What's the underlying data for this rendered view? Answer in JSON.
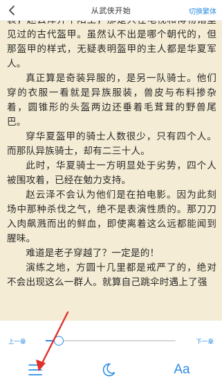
{
  "header": {
    "title": "从武侠开始",
    "action_label": "切换繁体"
  },
  "content": {
    "paragraphs": [
      "装，赵云泽并不陌生，那是只在电视和博物馆里见过的古代盔甲。虽然认不出是哪个朝代的，但那盔甲的样式，无疑表明盔甲的主人都是华夏军人。",
      "真正算是奇装异服的，是另一队骑士。他们穿的衣服一看就是异族服装，兽皮与布料掺杂着，圆锥形的头盔两边还垂着毛茸茸的野兽尾巴。",
      "穿华夏盔甲的骑士人数很少，只有四个人。而那队异族骑士，却有二三十人。",
      "此时，华夏骑士一方明显处于劣势，四个人被围攻着，已经在勉力支持。",
      "赵云泽不会认为他们是在拍电影。因为此刻场中那种杀伐之气，绝不是表演性质的。那刀刀入肉飙溅而出的鲜血，即使离着这么远都能闻到腥味。",
      "难道是老子穿越了？一定是的！",
      "演练之地，方圆十几里都是戒严了的，绝对不会出现这么一群人。就算自己跳伞时遇上了强"
    ]
  },
  "toolbar": {
    "prev_label": "上一章",
    "next_label": "下一章",
    "progress_percent": 10,
    "accent_color": "#2f8de4",
    "tools": [
      {
        "icon": "menu-icon"
      },
      {
        "icon": "moon-icon"
      },
      {
        "icon": "font-size-icon",
        "glyph": "Aa"
      }
    ]
  }
}
